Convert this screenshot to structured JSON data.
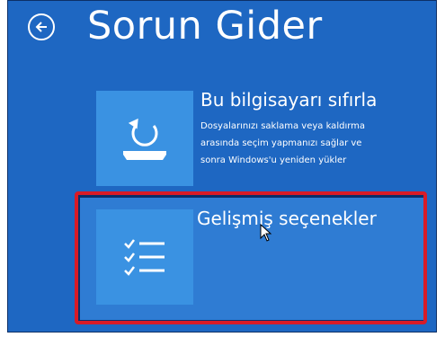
{
  "header": {
    "title": "Sorun Gider"
  },
  "options": [
    {
      "title": "Bu bilgisayarı sıfırla",
      "description": "Dosyalarınızı saklama veya kaldırma arasında seçim yapmanızı sağlar ve sonra Windows'u yeniden yükler",
      "icon": "reset-pc-icon"
    },
    {
      "title": "Gelişmiş seçenekler",
      "icon": "checklist-icon",
      "highlighted": true
    }
  ],
  "colors": {
    "background": "#1e67c2",
    "tile": "#3a92e2",
    "highlight_panel": "#2f7cd3",
    "annotation_box": "#d81b27",
    "text": "#ffffff"
  }
}
